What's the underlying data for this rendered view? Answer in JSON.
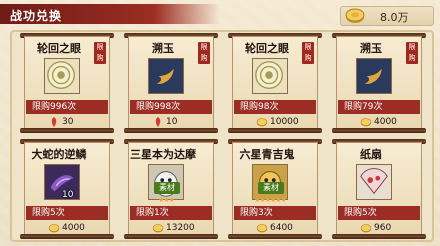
{
  "header": {
    "title": "战功兑换",
    "currency_value": "8.0万"
  },
  "cards": [
    {
      "name": "轮回之眼",
      "tag": "限购",
      "limit": "限购996次",
      "price": "30",
      "price_icon": "red-soul-icon",
      "item_icon": "eye-icon",
      "qty": ""
    },
    {
      "name": "溯玉",
      "tag": "限购",
      "limit": "限购998次",
      "price": "10",
      "price_icon": "red-soul-icon",
      "item_icon": "jade-icon",
      "qty": ""
    },
    {
      "name": "轮回之眼",
      "tag": "限购",
      "limit": "限购98次",
      "price": "10000",
      "price_icon": "gold-coin-icon",
      "item_icon": "eye-icon",
      "qty": ""
    },
    {
      "name": "溯玉",
      "tag": "限购",
      "limit": "限购79次",
      "price": "4000",
      "price_icon": "gold-coin-icon",
      "item_icon": "jade-icon",
      "qty": ""
    },
    {
      "name": "大蛇的逆鳞",
      "tag": "",
      "limit": "限购5次",
      "price": "4000",
      "price_icon": "gold-coin-icon",
      "item_icon": "scale-icon",
      "qty": "10"
    },
    {
      "name": "三星本为达摩",
      "tag": "",
      "limit": "限购1次",
      "price": "13200",
      "price_icon": "gold-coin-icon",
      "item_icon": "daruma-icon",
      "qty": "",
      "badge": "素材",
      "stars": "★★★"
    },
    {
      "name": "六星青吉鬼",
      "tag": "",
      "limit": "限购3次",
      "price": "6400",
      "price_icon": "gold-coin-icon",
      "item_icon": "oni-icon",
      "qty": "",
      "badge": "素材",
      "stars": "★★★★★★"
    },
    {
      "name": "纸扇",
      "tag": "",
      "limit": "限购5次",
      "price": "960",
      "price_icon": "gold-coin-icon",
      "item_icon": "fan-icon",
      "qty": ""
    }
  ],
  "colors": {
    "header_red": "#9b2d24",
    "limit_red": "#9b2d24",
    "scroll_bg": "#f1e3c4"
  }
}
